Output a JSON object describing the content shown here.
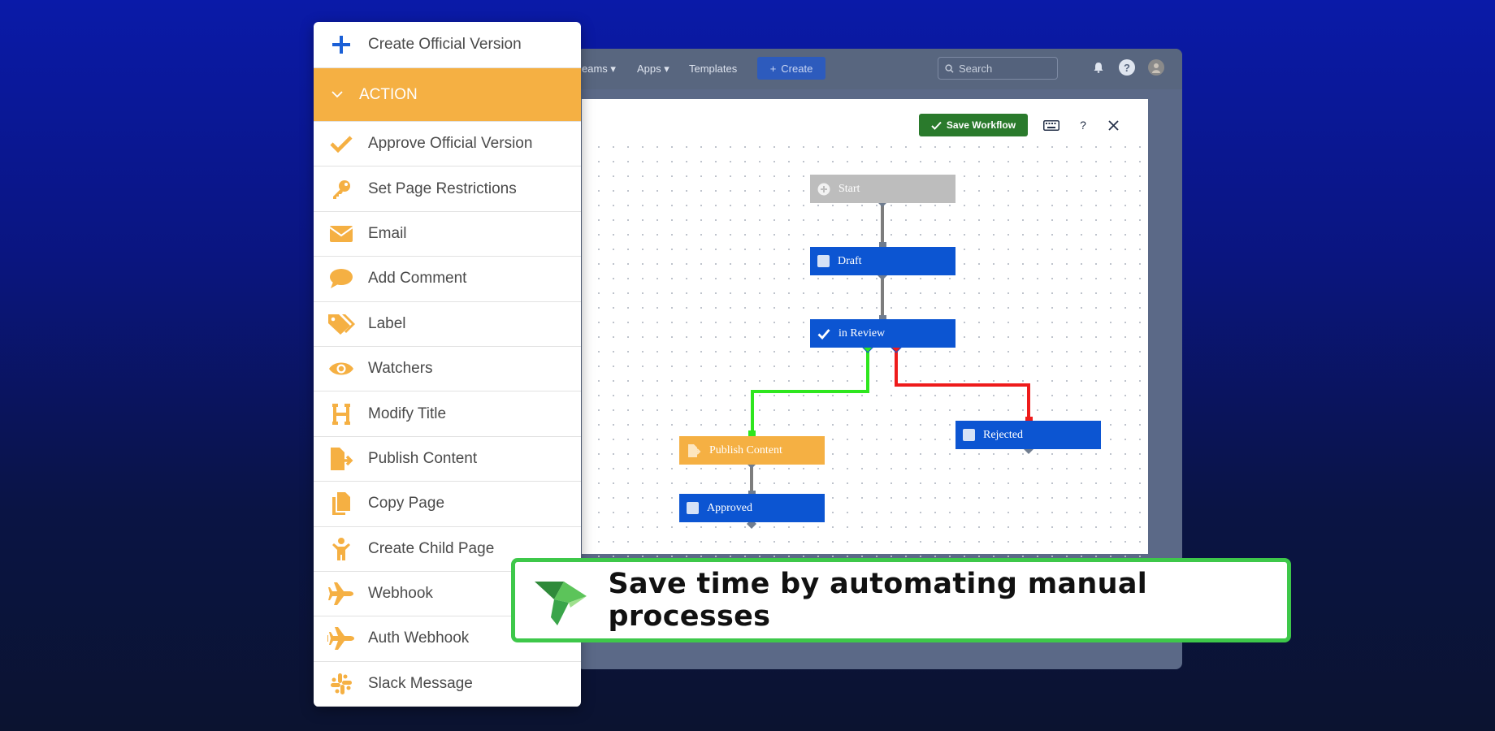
{
  "app": {
    "nav": {
      "teams": "eams",
      "apps": "Apps",
      "templates": "Templates"
    },
    "create_label": "Create",
    "search_placeholder": "Search"
  },
  "modal": {
    "save_label": "Save Workflow",
    "help": "?"
  },
  "workflow": {
    "nodes": {
      "start": "Start",
      "draft": "Draft",
      "in_review": "in Review",
      "publish": "Publish Content",
      "approved": "Approved",
      "rejected": "Rejected"
    },
    "colors": {
      "state": "#0c55d2",
      "action": "#f5b043",
      "start": "#bdbdbd",
      "approve_path": "#2ee61e",
      "reject_path": "#ee1b1b"
    }
  },
  "panel": {
    "create_label": "Create Official Version",
    "section_label": "ACTION",
    "items": [
      {
        "label": "Approve Official Version",
        "icon": "check-icon"
      },
      {
        "label": "Set Page Restrictions",
        "icon": "key-icon"
      },
      {
        "label": "Email",
        "icon": "envelope-icon"
      },
      {
        "label": "Add Comment",
        "icon": "comment-icon"
      },
      {
        "label": "Label",
        "icon": "tags-icon"
      },
      {
        "label": "Watchers",
        "icon": "eye-icon"
      },
      {
        "label": "Modify Title",
        "icon": "heading-icon"
      },
      {
        "label": "Publish Content",
        "icon": "file-export-icon"
      },
      {
        "label": "Copy Page",
        "icon": "copy-icon"
      },
      {
        "label": "Create Child Page",
        "icon": "child-icon"
      },
      {
        "label": "Webhook",
        "icon": "plane-icon"
      },
      {
        "label": "Auth Webhook",
        "icon": "plane-arrival-icon"
      },
      {
        "label": "Slack Message",
        "icon": "slack-icon"
      }
    ]
  },
  "banner": {
    "text": "Save time by automating manual processes"
  }
}
